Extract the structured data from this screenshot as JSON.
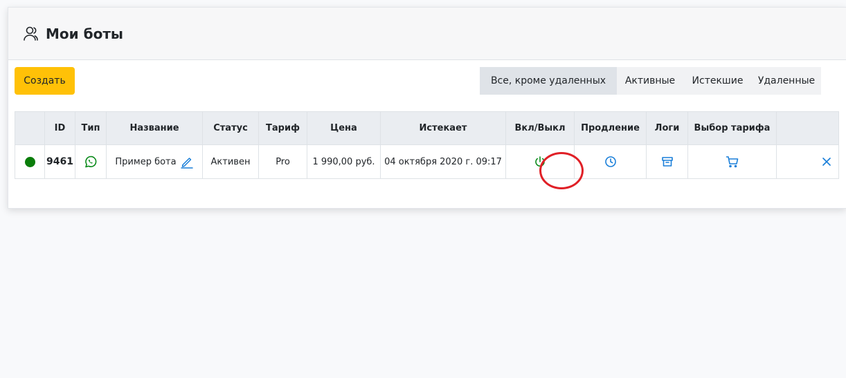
{
  "header": {
    "title": "Мои боты"
  },
  "toolbar": {
    "create_label": "Создать"
  },
  "filters": {
    "tabs": [
      {
        "label": "Все, кроме удаленных",
        "active": true
      },
      {
        "label": "Активные",
        "active": false
      },
      {
        "label": "Истекшие",
        "active": false
      },
      {
        "label": "Удаленные",
        "active": false
      }
    ]
  },
  "table": {
    "columns": [
      "",
      "ID",
      "Тип",
      "Название",
      "Статус",
      "Тариф",
      "Цена",
      "Истекает",
      "Вкл/Выкл",
      "Продление",
      "Логи",
      "Выбор тарифа",
      ""
    ],
    "rows": [
      {
        "status_dot_color": "#0a7d0a",
        "id": "9461",
        "type_icon": "whatsapp-icon",
        "name": "Пример бота",
        "status": "Активен",
        "tariff": "Pro",
        "price": "1 990,00 руб.",
        "expires": "04 октября 2020 г. 09:17",
        "power_icon": "power-icon",
        "extend_icon": "clock-icon",
        "logs_icon": "archive-icon",
        "tariff_icon": "cart-icon",
        "delete_icon": "close-icon"
      }
    ]
  },
  "colors": {
    "primary": "#ffc107",
    "accent": "#1a7fd9",
    "success": "#0a8a1a",
    "highlight": "#e02027"
  }
}
